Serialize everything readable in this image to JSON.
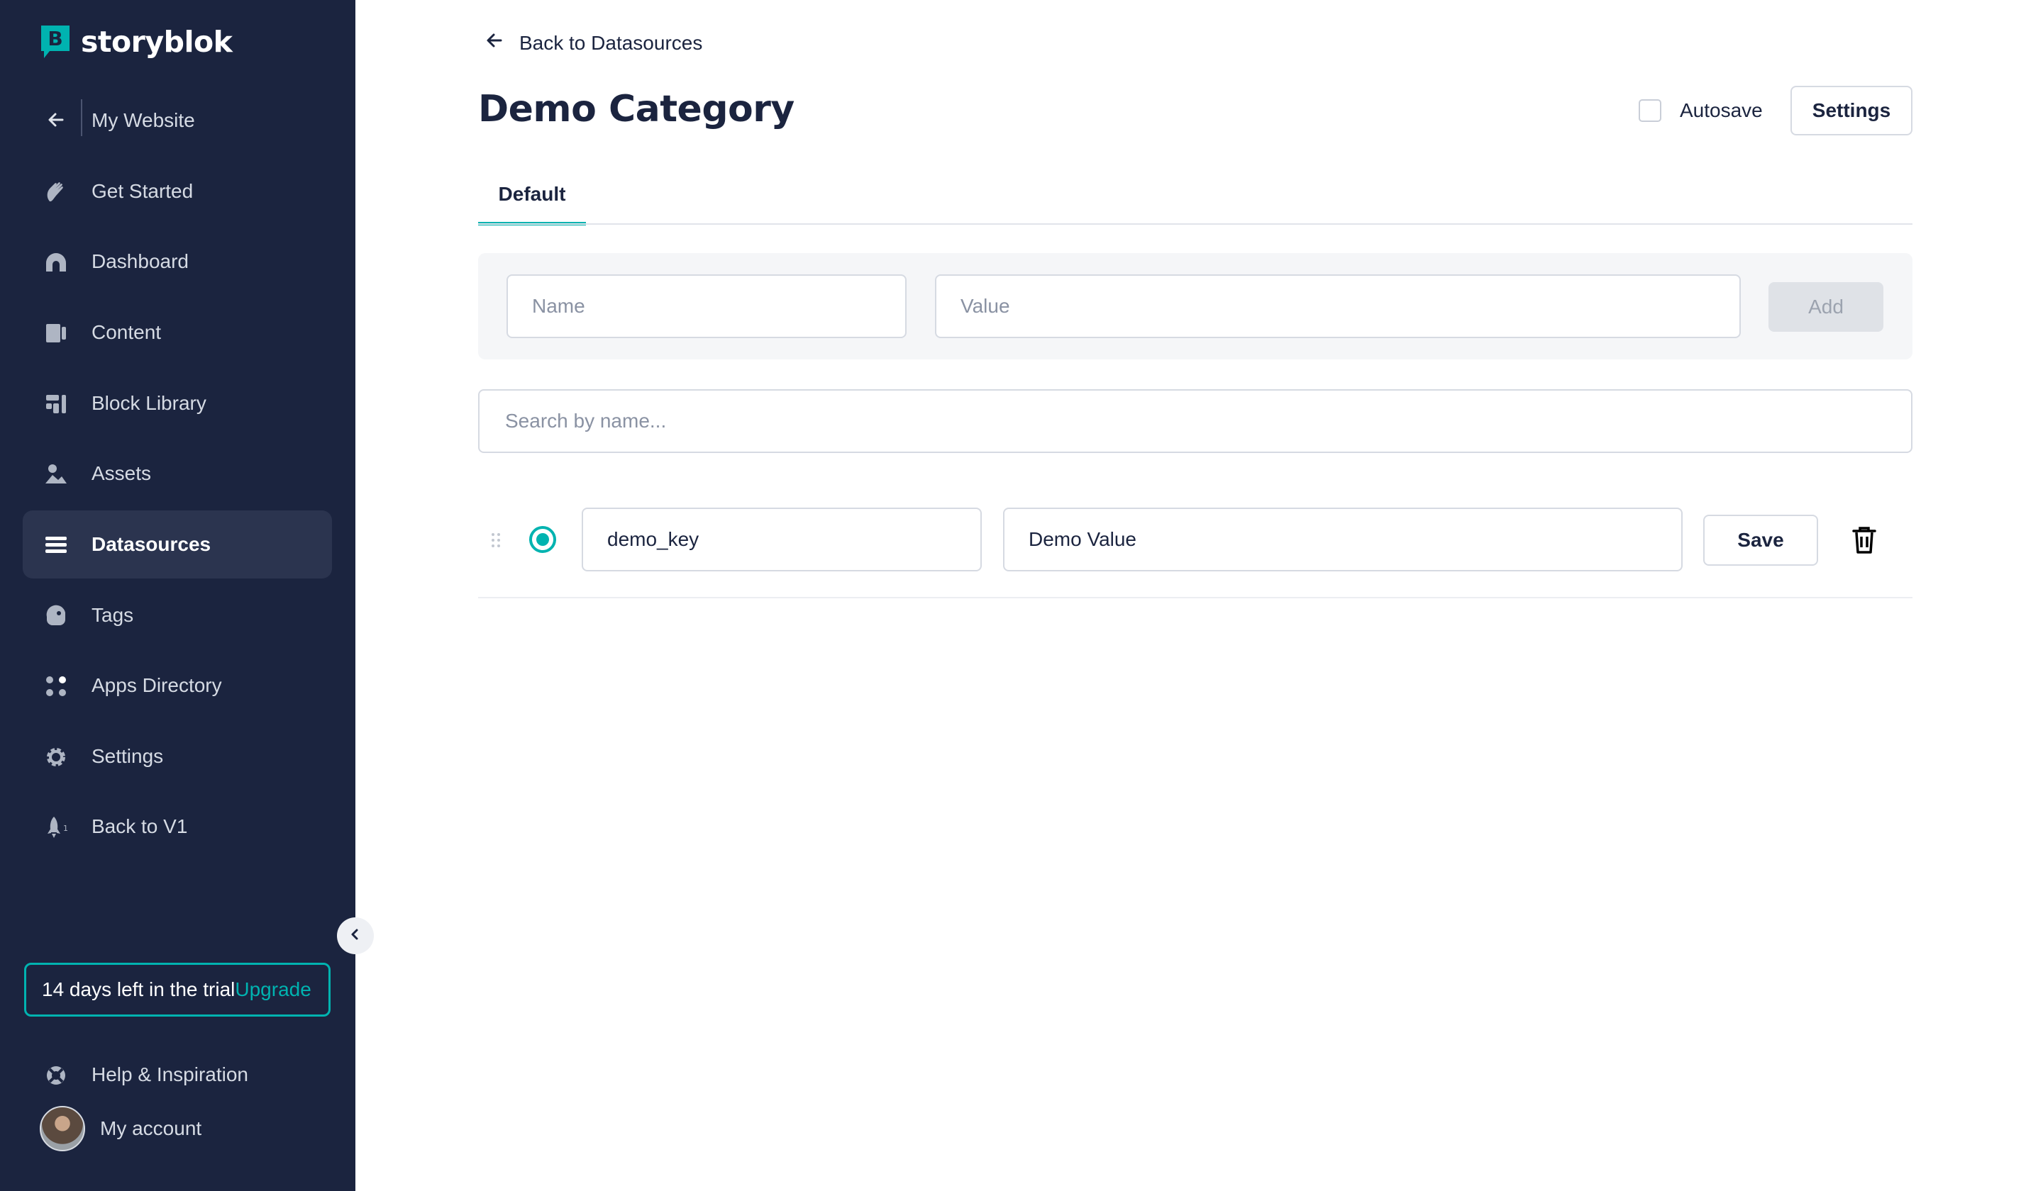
{
  "brand": {
    "name": "storyblok",
    "logo_letter": "B"
  },
  "sidebar": {
    "back_label": "My Website",
    "items": [
      {
        "label": "Get Started",
        "icon": "hand-wave-icon"
      },
      {
        "label": "Dashboard",
        "icon": "dashboard-icon"
      },
      {
        "label": "Content",
        "icon": "content-icon"
      },
      {
        "label": "Block Library",
        "icon": "block-library-icon"
      },
      {
        "label": "Assets",
        "icon": "assets-icon"
      },
      {
        "label": "Datasources",
        "icon": "datasources-icon",
        "active": true
      },
      {
        "label": "Tags",
        "icon": "tag-icon"
      },
      {
        "label": "Apps Directory",
        "icon": "apps-icon"
      },
      {
        "label": "Settings",
        "icon": "gear-icon"
      },
      {
        "label": "Back to V1",
        "icon": "rocket-icon"
      }
    ],
    "trial": {
      "text": "14 days left in the trial",
      "link": "Upgrade"
    },
    "help_label": "Help & Inspiration",
    "account_label": "My account"
  },
  "header": {
    "back_link": "Back to Datasources",
    "title": "Demo Category",
    "autosave_label": "Autosave",
    "autosave_checked": false,
    "settings_label": "Settings"
  },
  "tabs": [
    {
      "label": "Default",
      "active": true
    }
  ],
  "add_form": {
    "name_placeholder": "Name",
    "value_placeholder": "Value",
    "add_label": "Add"
  },
  "search": {
    "placeholder": "Search by name..."
  },
  "entries": [
    {
      "name": "demo_key",
      "value": "Demo Value",
      "save_label": "Save"
    }
  ],
  "colors": {
    "sidebar_bg": "#1b243f",
    "accent": "#00b3b0",
    "text_dark": "#1b243f"
  }
}
